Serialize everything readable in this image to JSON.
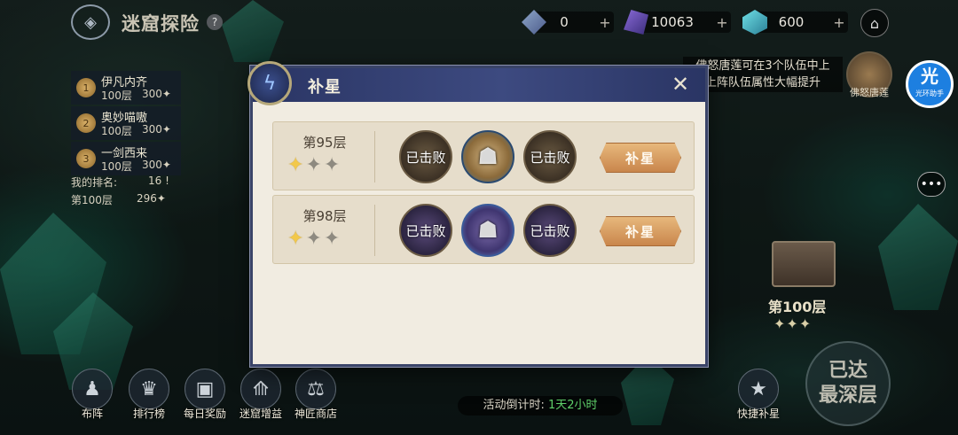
{
  "header": {
    "title": "迷窟探险",
    "help_icon": "?",
    "resources": [
      {
        "icon": "gem-a",
        "value": "0",
        "plus": "+"
      },
      {
        "icon": "gem-b",
        "value": "10063",
        "plus": "+"
      },
      {
        "icon": "gem-c",
        "value": "600",
        "plus": "+"
      }
    ]
  },
  "leaderboard": {
    "entries": [
      {
        "name": "伊凡内齐",
        "floor": "100层",
        "score": "300✦"
      },
      {
        "name": "奥妙喵嗷",
        "floor": "100层",
        "score": "300✦"
      },
      {
        "name": "一剑西来",
        "floor": "100层",
        "score": "300✦"
      }
    ],
    "my_rank_label": "我的排名:",
    "my_rank_value": "16 !",
    "my_floor_label": "第100层",
    "my_floor_value": "296✦"
  },
  "notice": {
    "line1": "佛怒唐莲可在3个队伍中上",
    "line2": "上阵队伍属性大幅提升",
    "hero_label": "佛怒唐莲"
  },
  "assist": {
    "glyph": "光",
    "label": "光环助手"
  },
  "deepest": {
    "floor_label": "第100层",
    "stars": "✦✦✦",
    "line1": "已达",
    "line2": "最深层"
  },
  "bottom": {
    "buttons": [
      {
        "label": "布阵",
        "icon": "team-icon"
      },
      {
        "label": "排行榜",
        "icon": "trophy-icon"
      },
      {
        "label": "每日奖励",
        "icon": "chest-icon"
      },
      {
        "label": "迷窟增益",
        "icon": "buff-icon"
      },
      {
        "label": "神匠商店",
        "icon": "scale-icon"
      }
    ],
    "quick_star": "快捷补星",
    "countdown_label": "活动倒计时:",
    "countdown_value": "1天2小时"
  },
  "modal": {
    "title": "补星",
    "rows": [
      {
        "floor": "第95层",
        "stars_earned": 1,
        "stars_total": 3,
        "enemies": [
          {
            "state": "defeated",
            "text": "已击败"
          },
          {
            "state": "active",
            "text": ""
          },
          {
            "state": "defeated",
            "text": "已击败"
          }
        ],
        "button": "补星"
      },
      {
        "floor": "第98层",
        "stars_earned": 1,
        "stars_total": 3,
        "enemies": [
          {
            "state": "defeated",
            "text": "已击败"
          },
          {
            "state": "active",
            "text": ""
          },
          {
            "state": "defeated",
            "text": "已击败"
          }
        ],
        "button": "补星"
      }
    ]
  }
}
